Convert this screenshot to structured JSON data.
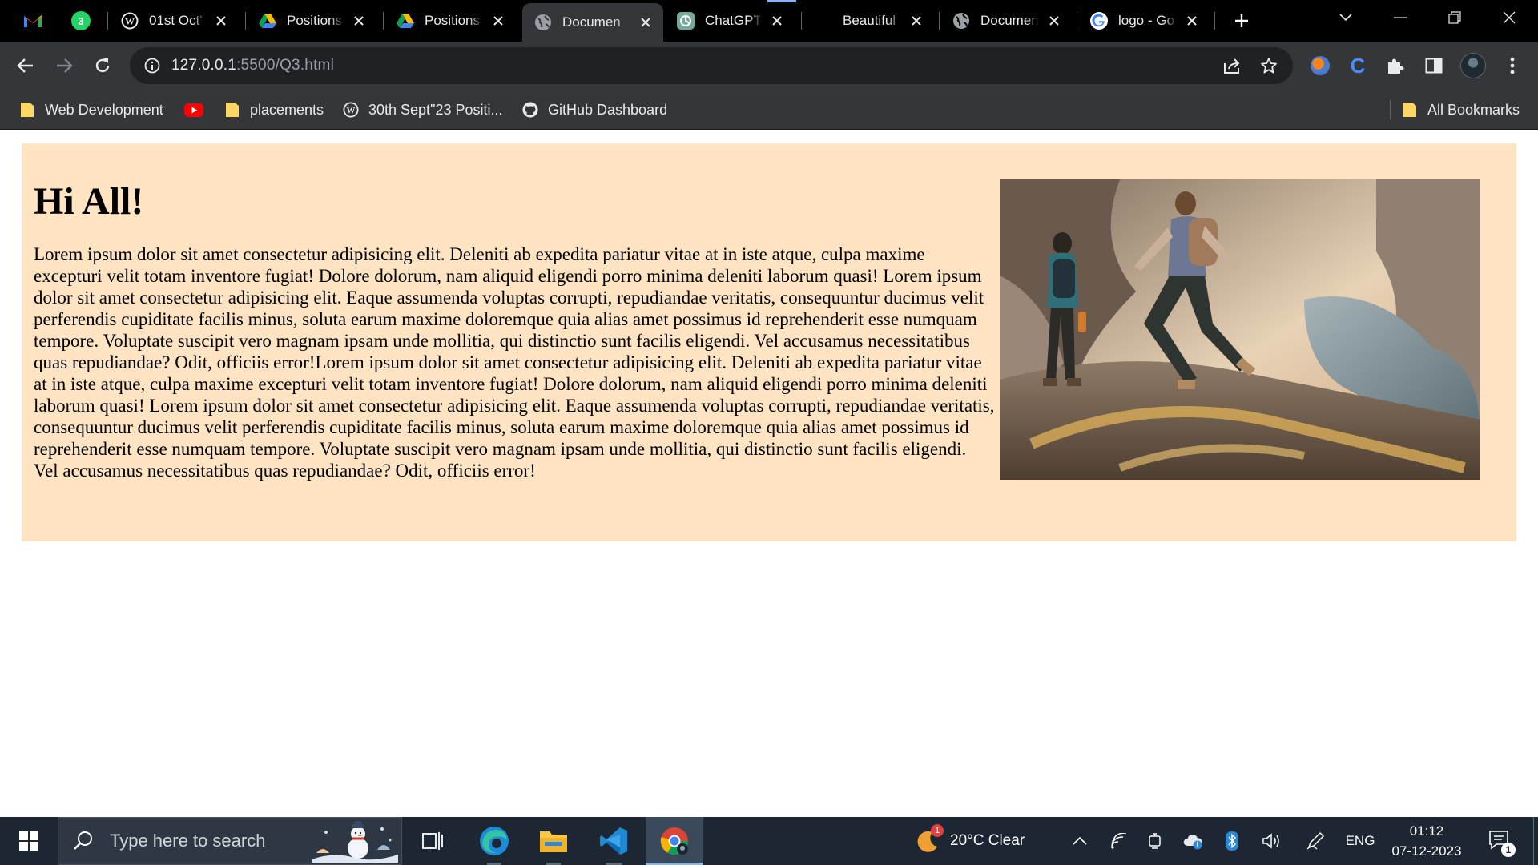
{
  "browser": {
    "tabs": [
      {
        "title": "01st Oct'",
        "icon": "wordpress-icon"
      },
      {
        "title": "Positions",
        "icon": "google-drive-icon"
      },
      {
        "title": "Positions",
        "icon": "google-drive-icon"
      },
      {
        "title": "Documen",
        "icon": "globe-icon",
        "active": true
      },
      {
        "title": "ChatGPT",
        "icon": "chatgpt-icon"
      },
      {
        "title": "Beautiful",
        "icon": "blank-icon"
      },
      {
        "title": "Documen",
        "icon": "globe-icon"
      },
      {
        "title": "logo - Go",
        "icon": "google-icon"
      }
    ],
    "pinned_tabs": [
      "gmail-icon",
      "whatsapp-icon"
    ],
    "whatsapp_badge": "3",
    "address": {
      "host": "127.0.0.1",
      "path": ":5500/Q3.html"
    },
    "bookmarks": [
      {
        "label": "Web Development",
        "icon": "folder-icon"
      },
      {
        "label": "",
        "icon": "youtube-icon"
      },
      {
        "label": "placements",
        "icon": "folder-icon"
      },
      {
        "label": "30th Sept\"23 Positi...",
        "icon": "wordpress-icon"
      },
      {
        "label": "GitHub Dashboard",
        "icon": "github-icon"
      }
    ],
    "all_bookmarks_label": "All Bookmarks"
  },
  "page": {
    "heading": "Hi All!",
    "paragraph": "Lorem ipsum dolor sit amet consectetur adipisicing elit. Deleniti ab expedita pariatur vitae at in iste atque, culpa maxime excepturi velit totam inventore fugiat! Dolore dolorum, nam aliquid eligendi porro minima deleniti laborum quasi! Lorem ipsum dolor sit amet consectetur adipisicing elit. Eaque assumenda voluptas corrupti, repudiandae veritatis, consequuntur ducimus velit perferendis cupiditate facilis minus, soluta earum maxime doloremque quia alias amet possimus id reprehenderit esse numquam tempore. Voluptate suscipit vero magnam ipsam unde mollitia, qui distinctio sunt facilis eligendi. Vel accusamus necessitatibus quas repudiandae? Odit, officiis error!Lorem ipsum dolor sit amet consectetur adipisicing elit. Deleniti ab expedita pariatur vitae at in iste atque, culpa maxime excepturi velit totam inventore fugiat! Dolore dolorum, nam aliquid eligendi porro minima deleniti laborum quasi! Lorem ipsum dolor sit amet consectetur adipisicing elit. Eaque assumenda voluptas corrupti, repudiandae veritatis, consequuntur ducimus velit perferendis cupiditate facilis minus, soluta earum maxime doloremque quia alias amet possimus id reprehenderit esse numquam tempore. Voluptate suscipit vero magnam ipsam unde mollitia, qui distinctio sunt facilis eligendi. Vel accusamus necessitatibus quas repudiandae? Odit, officiis error!",
    "card_color": "#ffe4c4"
  },
  "taskbar": {
    "search_placeholder": "Type here to search",
    "weather": "20°C  Clear",
    "weather_badge": "1",
    "language": "ENG",
    "time": "01:12",
    "date": "07-12-2023",
    "notification_count": "1"
  }
}
